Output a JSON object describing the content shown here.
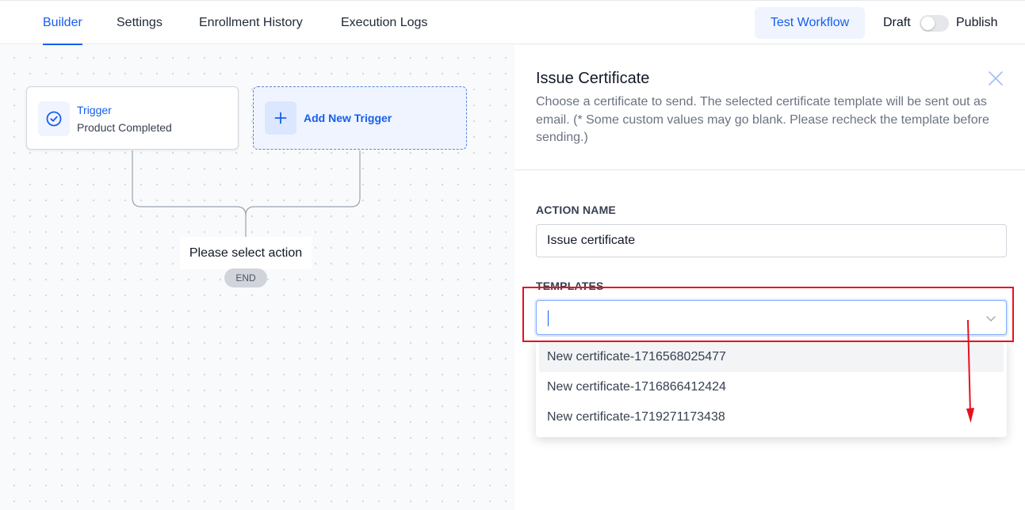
{
  "nav": {
    "tabs": [
      {
        "label": "Builder",
        "active": true
      },
      {
        "label": "Settings"
      },
      {
        "label": "Enrollment History"
      },
      {
        "label": "Execution Logs"
      }
    ],
    "test_button": "Test Workflow",
    "draft_label": "Draft",
    "publish_label": "Publish",
    "publish_toggle_on": false
  },
  "canvas": {
    "trigger": {
      "title": "Trigger",
      "subtitle": "Product Completed",
      "icon": "check-circle-icon"
    },
    "add_trigger": {
      "label": "Add New Trigger",
      "icon": "plus-icon"
    },
    "action_placeholder": "Please select action",
    "end_label": "END"
  },
  "panel": {
    "title": "Issue Certificate",
    "description": "Choose a certificate to send. The selected certificate template will be sent out as email. (* Some custom values may go blank. Please recheck the template before sending.)",
    "action_name_label": "ACTION NAME",
    "action_name_value": "Issue certificate",
    "templates_label": "TEMPLATES",
    "templates_value": "",
    "template_options": [
      "New certificate-1716568025477",
      "New certificate-1716866412424",
      "New certificate-1719271173438"
    ],
    "highlighted_option_index": 0
  },
  "colors": {
    "accent": "#155eef",
    "annotation": "#e8101d"
  }
}
